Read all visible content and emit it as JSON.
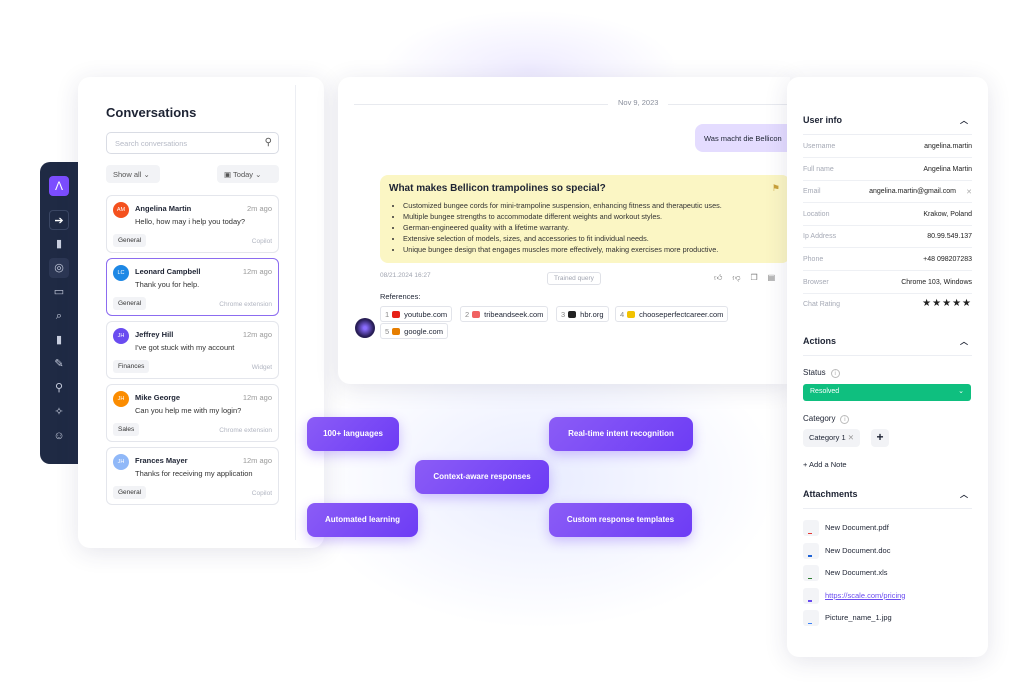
{
  "conversations": {
    "title": "Conversations",
    "search_placeholder": "Search conversations",
    "filter": "Show all",
    "date_filter": "Today",
    "items": [
      {
        "initials": "AM",
        "name": "Angelina Martin",
        "time": "2m ago",
        "message": "Hello, how may i help you today?",
        "tag": "General",
        "source": "Copilot",
        "color": "#f4511e"
      },
      {
        "initials": "LC",
        "name": "Leonard Campbell",
        "time": "12m ago",
        "message": "Thank you for help.",
        "tag": "General",
        "source": "Chrome extension",
        "color": "#1e88e5"
      },
      {
        "initials": "JH",
        "name": "Jeffrey Hill",
        "time": "12m ago",
        "message": "I've got stuck with my account",
        "tag": "Finances",
        "source": "Widget",
        "color": "#6a4cf0"
      },
      {
        "initials": "JH",
        "name": "Mike George",
        "time": "12m ago",
        "message": "Can you help me with my login?",
        "tag": "Sales",
        "source": "Chrome extension",
        "color": "#fb8c00"
      },
      {
        "initials": "JH",
        "name": "Frances Mayer",
        "time": "12m ago",
        "message": "Thanks for receiving my application",
        "tag": "General",
        "source": "Copilot",
        "color": "#90b8f8"
      }
    ]
  },
  "chat": {
    "date": "Nov 9, 2023",
    "user_message": "Was macht die Bellicon",
    "answer_title": "What makes Bellicon trampolines so special?",
    "answer_points": [
      "Customized bungee cords for mini-trampoline suspension, enhancing fitness and therapeutic uses.",
      "Multiple bungee strengths to accommodate different weights and workout styles.",
      "German-engineered quality with a lifetime warranty.",
      "Extensive selection of models, sizes, and accessories to fit individual needs.",
      "Unique bungee design that engages muscles more effectively, making exercises more productive."
    ],
    "timestamp": "08/21.2024  16:27",
    "badge": "Trained query",
    "references_label": "References:",
    "references": [
      {
        "n": "1",
        "site": "youtube.com",
        "color": "#e62117"
      },
      {
        "n": "2",
        "site": "tribeandseek.com",
        "color": "#f06262"
      },
      {
        "n": "3",
        "site": "hbr.org",
        "color": "#222222"
      },
      {
        "n": "4",
        "site": "chooseperfectcareer.com",
        "color": "#f2c200"
      },
      {
        "n": "5",
        "site": "google.com",
        "color": "#e67e00"
      }
    ]
  },
  "user_info": {
    "title": "User info",
    "fields": [
      {
        "k": "Username",
        "v": "angelina.martin"
      },
      {
        "k": "Full name",
        "v": "Angelina Martin"
      },
      {
        "k": "Email",
        "v": "angelina.martin@gmail.com"
      },
      {
        "k": "Location",
        "v": "Krakow, Poland"
      },
      {
        "k": "Ip Address",
        "v": "80.99.549.137"
      },
      {
        "k": "Phone",
        "v": "+48 098207283"
      },
      {
        "k": "Browser",
        "v": "Chrome 103, Windows"
      }
    ],
    "rating_label": "Chat Rating",
    "rating": 5
  },
  "actions": {
    "title": "Actions",
    "status_label": "Status",
    "status": "Resolved",
    "status_color": "#0fbf7f",
    "category_label": "Category",
    "category": "Category 1",
    "add_note": "+ Add a Note"
  },
  "attachments": {
    "title": "Attachments",
    "items": [
      {
        "name": "New Document.pdf",
        "color": "#e53935"
      },
      {
        "name": "New Document.doc",
        "color": "#1e63d6"
      },
      {
        "name": "New Document.xls",
        "color": "#2e7d32"
      },
      {
        "name": "https://scale.com/pricing",
        "color": "#6a4cf0"
      },
      {
        "name": "Picture_name_1.jpg",
        "color": "#3b82f6"
      }
    ]
  },
  "features": [
    "100+ languages",
    "Real-time intent recognition",
    "Context-aware responses",
    "Automated learning",
    "Custom response templates"
  ]
}
